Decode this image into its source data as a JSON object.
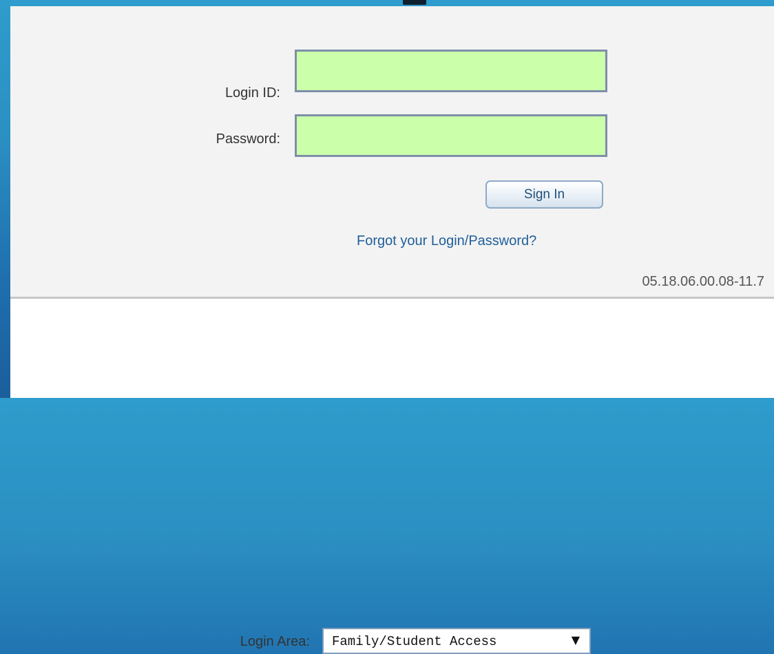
{
  "login_form": {
    "login_id_label": "Login ID:",
    "login_id_value": "",
    "password_label": "Password:",
    "password_value": "",
    "sign_in_label": "Sign In",
    "forgot_link_label": "Forgot your Login/Password?",
    "version": "05.18.06.00.08-11.7"
  },
  "login_area": {
    "label": "Login Area:",
    "selected": "Family/Student Access",
    "arrow_icon": "dropdown-arrow-icon"
  },
  "colors": {
    "field_background": "#ccffaa",
    "page_background": "#2b8fc2",
    "panel_background": "#f3f3f3",
    "link": "#1f5f99"
  }
}
